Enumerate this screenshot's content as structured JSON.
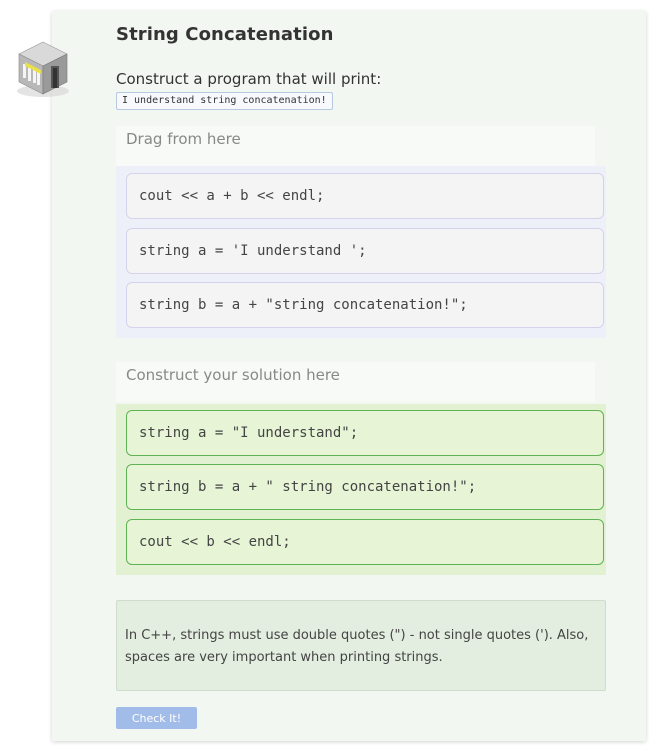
{
  "header": {
    "title": "String Concatenation",
    "icon": "building-icon"
  },
  "instructions": {
    "prompt": "Construct a program that will print:",
    "expected_output": "I understand string concatenation!"
  },
  "drag_area": {
    "label": "Drag from here",
    "blocks": [
      "cout << a + b << endl;",
      "string a = 'I understand ';",
      "string b = a + \"string concatenation!\";"
    ]
  },
  "solution_area": {
    "label": "Construct your solution here",
    "blocks": [
      "string a = \"I understand\";",
      "string b = a + \" string concatenation!\";",
      "cout << b << endl;"
    ]
  },
  "feedback": {
    "message": "In C++, strings must use double quotes (\") - not single quotes ('). Also, spaces are very important when printing strings."
  },
  "actions": {
    "check_label": "Check It!"
  },
  "colors": {
    "card_bg": "#f3f7f2",
    "drag_zone_bg": "#eef0f9",
    "solution_zone_bg": "#e3f1d3",
    "solution_block_border": "#5fb355",
    "check_button_bg": "#a2bcea"
  }
}
